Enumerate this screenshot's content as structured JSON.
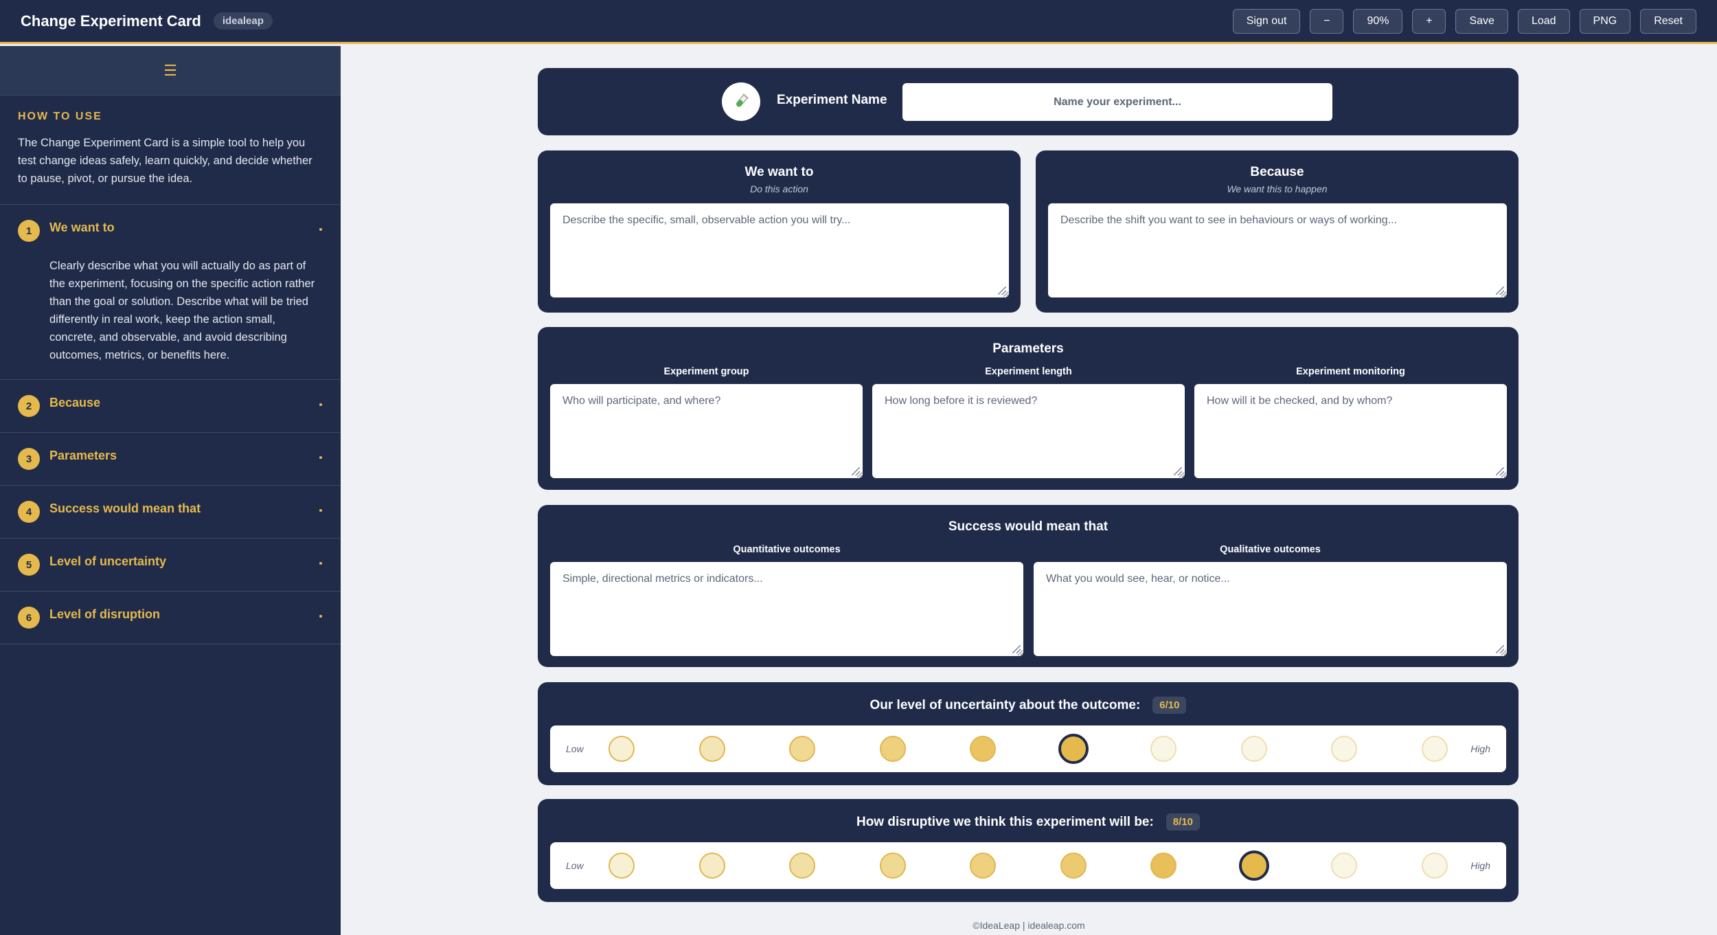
{
  "header": {
    "title": "Change Experiment Card",
    "brand": "idealeap",
    "buttons": {
      "sign_out": "Sign out",
      "zoom_out": "−",
      "zoom_level": "90%",
      "zoom_in": "+",
      "save": "Save",
      "load": "Load",
      "png": "PNG",
      "reset": "Reset"
    }
  },
  "sidebar": {
    "menu_icon": "hamburger-menu-icon",
    "howto_title": "HOW TO USE",
    "howto_text": "The Change Experiment Card is a simple tool to help you test change ideas safely, learn quickly, and decide whether to pause, pivot, or pursue the idea.",
    "items": [
      {
        "num": "1",
        "label": "We want to",
        "expanded": true,
        "body": "Clearly describe what you will actually do as part of the experiment, focusing on the specific action rather than the goal or solution. Describe what will be tried differently in real work, keep the action small, concrete, and observable, and avoid describing outcomes, metrics, or benefits here."
      },
      {
        "num": "2",
        "label": "Because",
        "expanded": false
      },
      {
        "num": "3",
        "label": "Parameters",
        "expanded": false
      },
      {
        "num": "4",
        "label": "Success would mean that",
        "expanded": false
      },
      {
        "num": "5",
        "label": "Level of uncertainty",
        "expanded": false
      },
      {
        "num": "6",
        "label": "Level of disruption",
        "expanded": false
      }
    ]
  },
  "name_card": {
    "icon": "test-tube-icon",
    "label": "Experiment Name",
    "placeholder": "Name your experiment...",
    "value": ""
  },
  "want_card": {
    "title": "We want to",
    "subtitle": "Do this action",
    "placeholder": "Describe the specific, small, observable action you will try...",
    "value": ""
  },
  "because_card": {
    "title": "Because",
    "subtitle": "We want this to happen",
    "placeholder": "Describe the shift you want to see in behaviours or ways of working...",
    "value": ""
  },
  "parameters": {
    "title": "Parameters",
    "fields": [
      {
        "label": "Experiment group",
        "placeholder": "Who will participate, and where?",
        "value": ""
      },
      {
        "label": "Experiment length",
        "placeholder": "How long before it is reviewed?",
        "value": ""
      },
      {
        "label": "Experiment monitoring",
        "placeholder": "How will it be checked, and by whom?",
        "value": ""
      }
    ]
  },
  "success": {
    "title": "Success would mean that",
    "fields": [
      {
        "label": "Quantitative outcomes",
        "placeholder": "Simple, directional metrics or indicators...",
        "value": ""
      },
      {
        "label": "Qualitative outcomes",
        "placeholder": "What you would see, hear, or notice...",
        "value": ""
      }
    ]
  },
  "uncertainty": {
    "title": "Our level of uncertainty about the outcome:",
    "score_text": "6/10",
    "selected": 6,
    "max": 10,
    "low_label": "Low",
    "high_label": "High"
  },
  "disruption": {
    "title": "How disruptive we think this experiment will be:",
    "score_text": "8/10",
    "selected": 8,
    "max": 10,
    "low_label": "Low",
    "high_label": "High"
  },
  "colors": {
    "navy": "#1f2b49",
    "gold": "#e6b94c",
    "page_bg": "#eff1f5"
  },
  "footer": "©IdeaLeap | idealeap.com"
}
